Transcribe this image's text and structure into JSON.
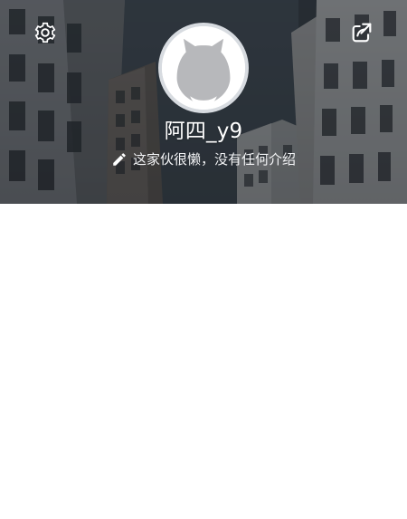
{
  "profile": {
    "username": "阿四_y9",
    "bio": "这家伙很懒，没有任何介绍"
  },
  "icons": {
    "settings": "gear-icon",
    "share": "share-icon",
    "edit": "pencil-icon",
    "avatar": "cat-avatar"
  },
  "colors": {
    "header_dark": "#2b3137",
    "header_mid": "#37404a",
    "avatar_border": "#d7dbe0",
    "text": "#ffffff",
    "content_bg": "#ffffff"
  }
}
